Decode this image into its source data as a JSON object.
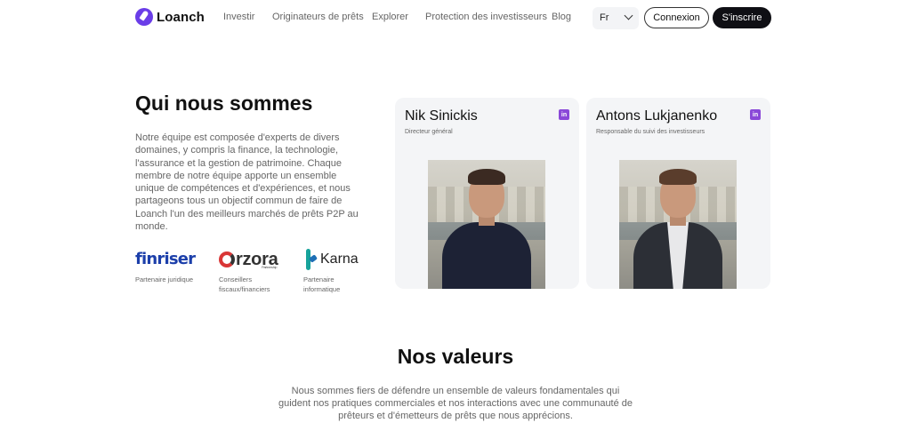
{
  "nav": {
    "logo_text": "Loanch",
    "links": [
      "Investir",
      "Originateurs de prêts",
      "Explorer",
      "Protection des investisseurs",
      "Blog"
    ],
    "language": "Fr",
    "login_label": "Connexion",
    "signup_label": "S'inscrire"
  },
  "about": {
    "title": "Qui nous sommes",
    "text": "Notre équipe est composée d'experts de divers domaines, y compris la finance, la technologie, l'assurance et la gestion de patrimoine. Chaque membre de notre équipe apporte un ensemble unique de compétences et d'expériences, et nous partageons tous un objectif commun de faire de Loanch l'un des meilleurs marchés de prêts P2P au monde.",
    "partners": [
      {
        "logo": "finriser",
        "label": "Partenaire juridique"
      },
      {
        "logo": "rzora",
        "logo_sub": "Partnership",
        "label": "Conseillers fiscaux/financiers"
      },
      {
        "logo": "Karna",
        "label": "Partenaire informatique"
      }
    ]
  },
  "team": [
    {
      "name": "Nik Sinickis",
      "role": "Directeur général",
      "icon": "linkedin-icon"
    },
    {
      "name": "Antons Lukjanenko",
      "role": "Responsable du suivi des investisseurs",
      "icon": "linkedin-icon"
    }
  ],
  "values": {
    "title": "Nos valeurs",
    "text": "Nous sommes fiers de défendre un ensemble de valeurs fondamentales qui guident nos pratiques commerciales et nos interactions avec une communauté de prêteurs et d'émetteurs de prêts que nous apprécions."
  },
  "colors": {
    "brand": "#6a3de8",
    "linkedin": "#8a48d8",
    "dark_button": "#0f0f14",
    "card_bg": "#f4f5f7"
  }
}
